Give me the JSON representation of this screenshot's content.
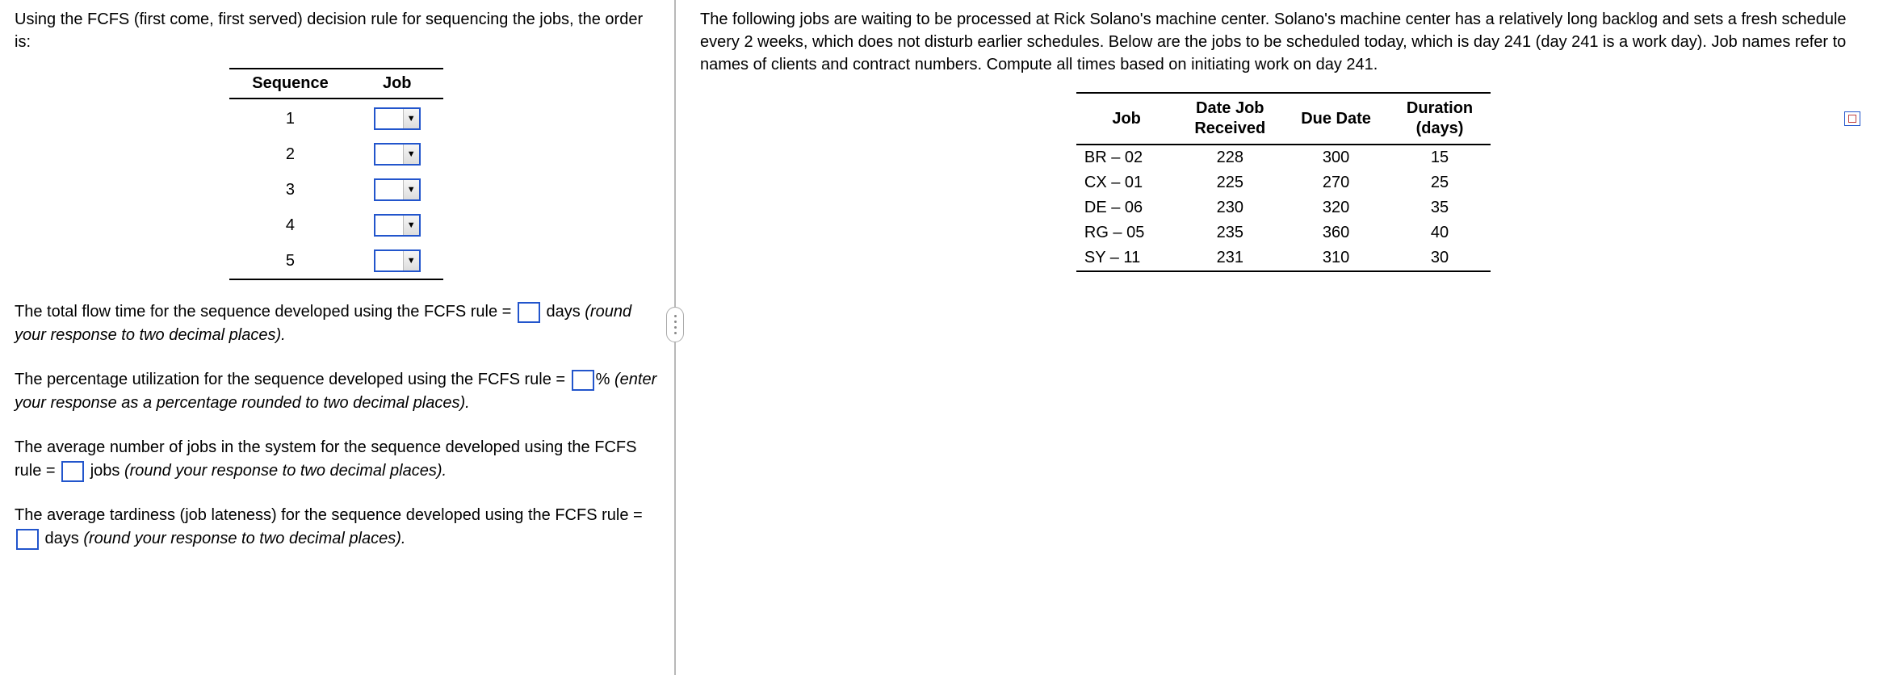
{
  "left": {
    "intro": "Using the FCFS (first come, first served) decision rule for sequencing the jobs, the order is:",
    "seqTable": {
      "headers": {
        "sequence": "Sequence",
        "job": "Job"
      },
      "rows": [
        {
          "seq": "1"
        },
        {
          "seq": "2"
        },
        {
          "seq": "3"
        },
        {
          "seq": "4"
        },
        {
          "seq": "5"
        }
      ]
    },
    "q1": {
      "pre": "The total flow time for the sequence developed using the FCFS rule = ",
      "post": " days ",
      "hint": "(round your response to two decimal places)."
    },
    "q2": {
      "pre": "The percentage utilization for the sequence developed using the FCFS rule = ",
      "post": "% ",
      "hint": "(enter your response as a percentage rounded to two decimal places)."
    },
    "q3": {
      "pre": "The average number of jobs in the system for the sequence developed using the FCFS rule = ",
      "post": " jobs ",
      "hint": "(round your response to two decimal places)."
    },
    "q4": {
      "pre": "The average tardiness (job lateness) for the sequence developed using the FCFS rule = ",
      "post": " days ",
      "hint": "(round your response to two decimal places)."
    }
  },
  "right": {
    "intro": "The following jobs are waiting to be processed at Rick Solano's machine center. Solano's machine center has a relatively long backlog and sets a fresh schedule every 2 weeks, which does not disturb earlier schedules. Below are the jobs to be scheduled today, which is day 241 (day 241 is a work day). Job names refer to names of clients and contract numbers. Compute all times based on initiating work on day 241.",
    "headers": {
      "job": "Job",
      "dateReceivedL1": "Date Job",
      "dateReceivedL2": "Received",
      "dueDate": "Due Date",
      "durationL1": "Duration",
      "durationL2": "(days)"
    },
    "rows": [
      {
        "job": "BR – 02",
        "received": "228",
        "due": "300",
        "duration": "15"
      },
      {
        "job": "CX – 01",
        "received": "225",
        "due": "270",
        "duration": "25"
      },
      {
        "job": "DE – 06",
        "received": "230",
        "due": "320",
        "duration": "35"
      },
      {
        "job": "RG – 05",
        "received": "235",
        "due": "360",
        "duration": "40"
      },
      {
        "job": "SY – 11",
        "received": "231",
        "due": "310",
        "duration": "30"
      }
    ]
  }
}
